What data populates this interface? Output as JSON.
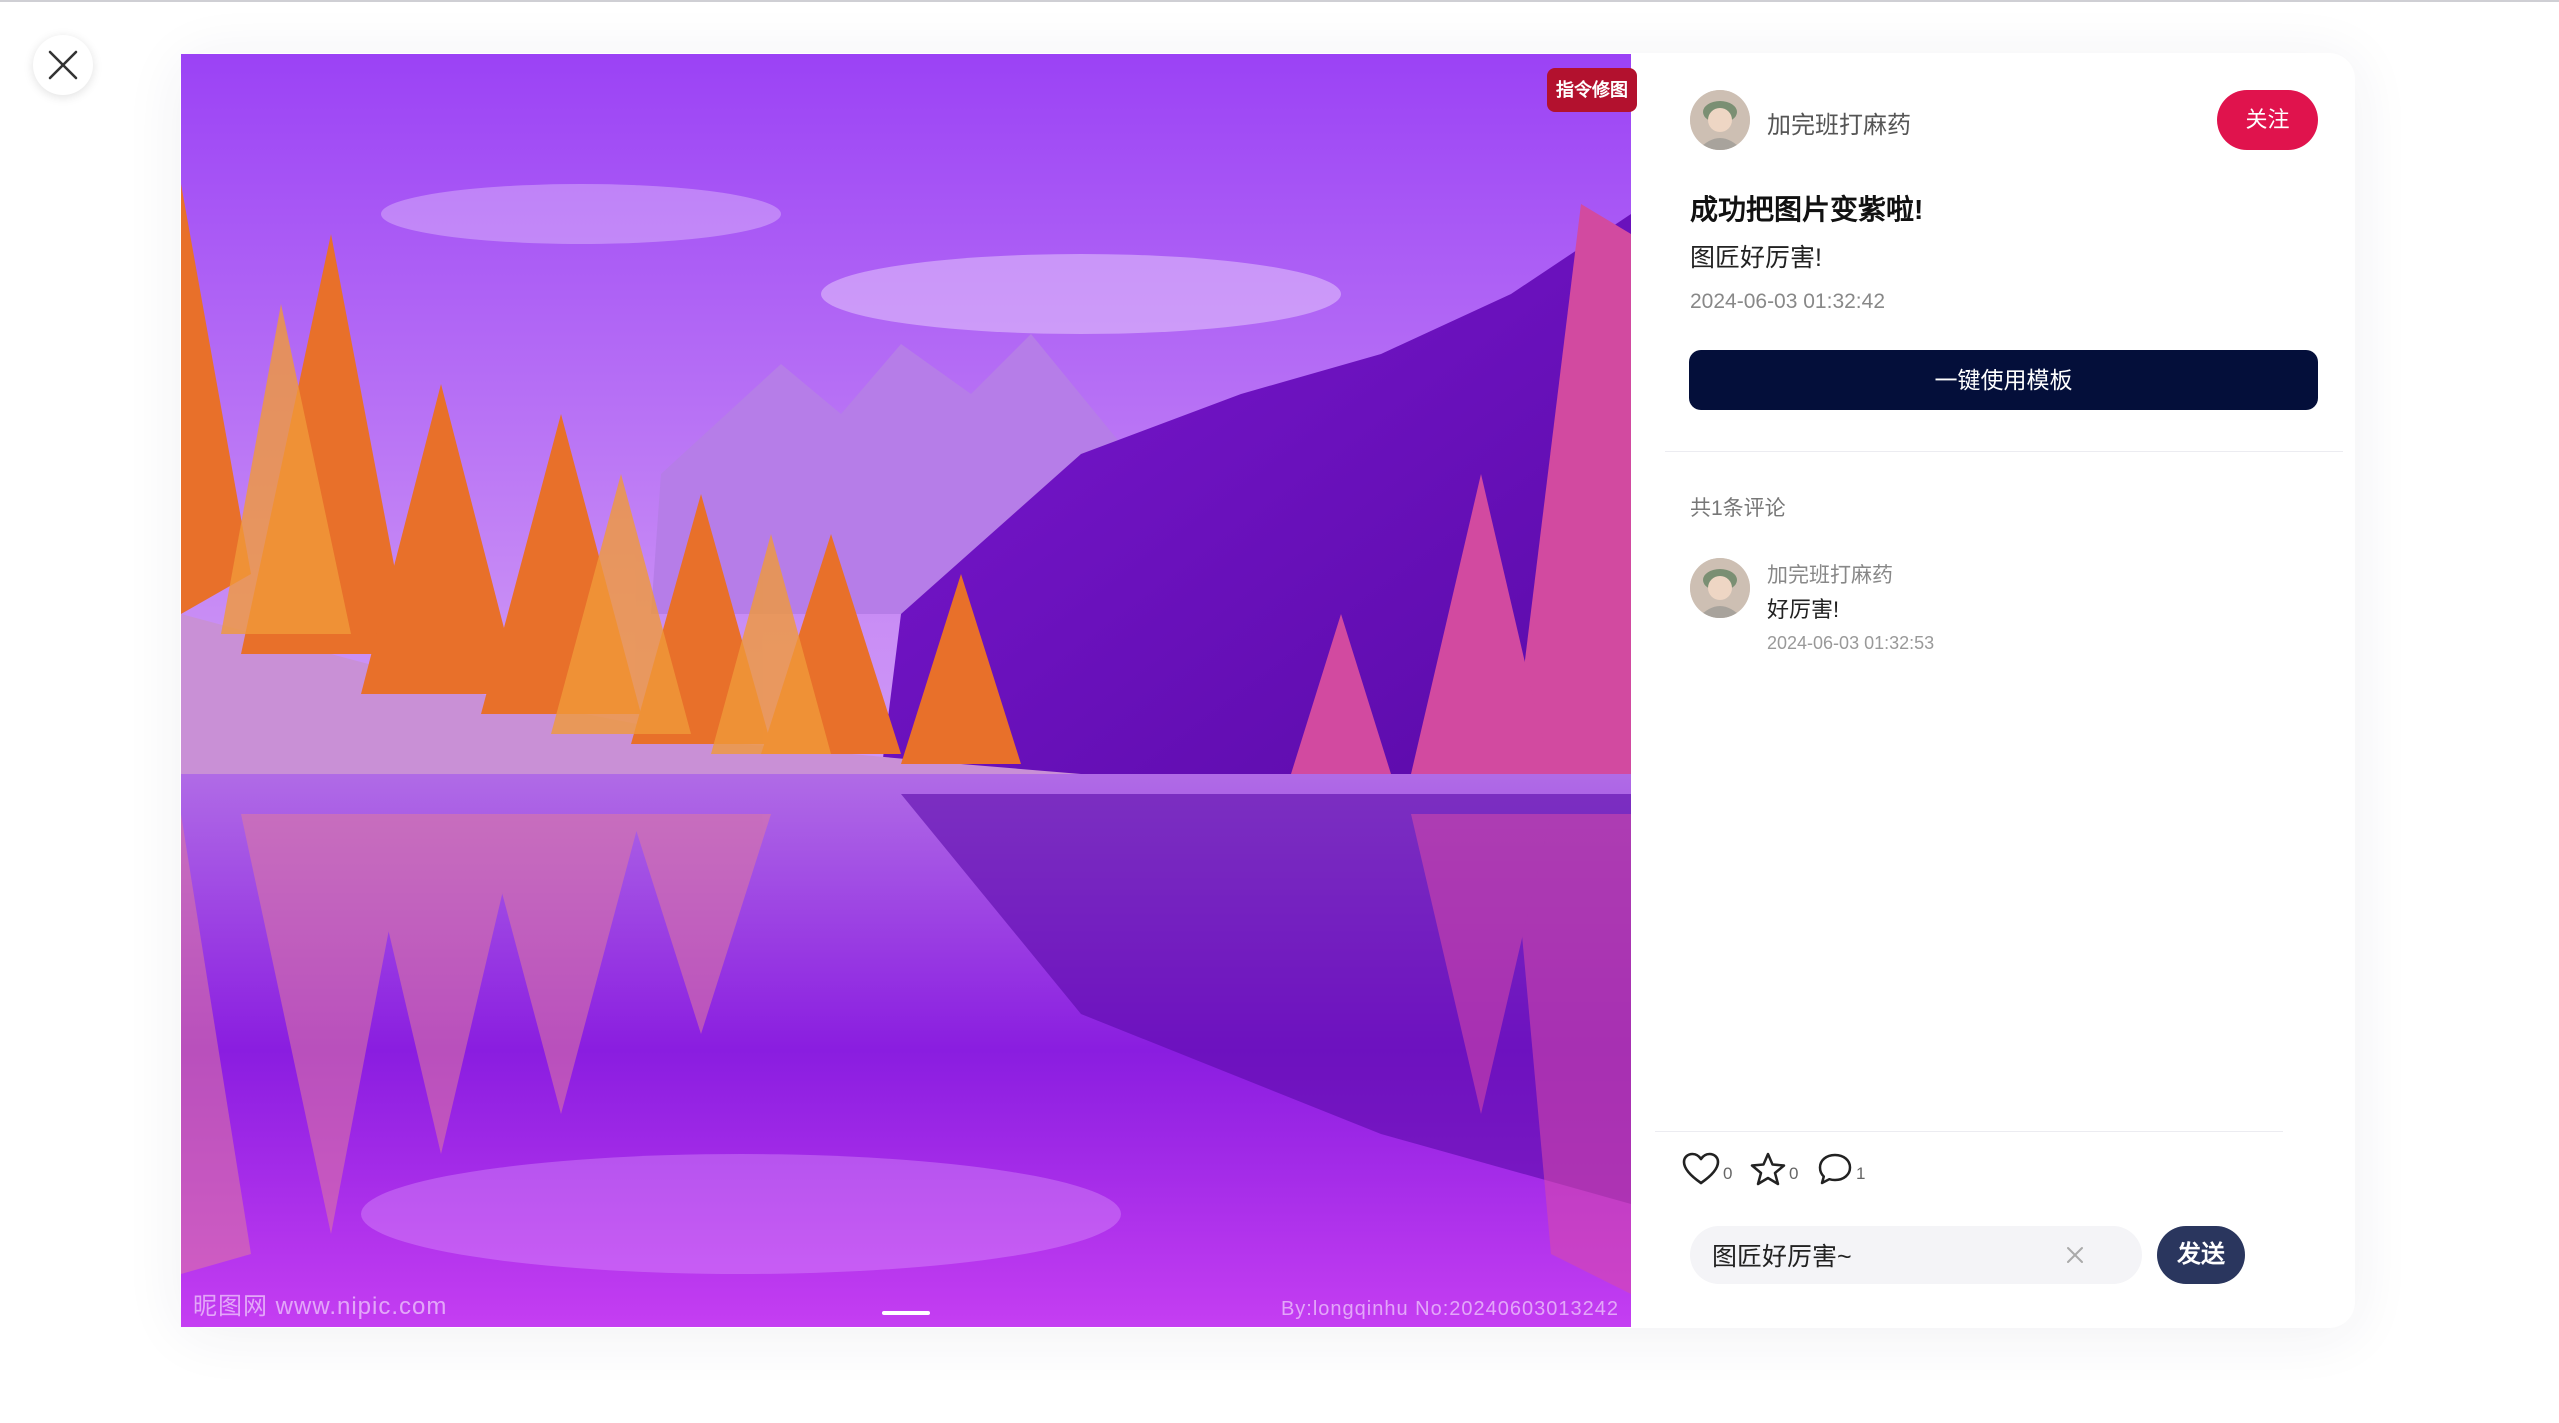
{
  "window": {
    "close_icon": "close-icon"
  },
  "image": {
    "tag_label": "指令修图",
    "watermark_left": "昵图网 www.nipic.com",
    "watermark_right": "By:longqinhu No:20240603013242"
  },
  "author": {
    "name": "加完班打麻药",
    "follow_label": "关注"
  },
  "post": {
    "title": "成功把图片变紫啦!",
    "description": "图匠好厉害!",
    "date": "2024-06-03 01:32:42",
    "use_template_label": "一键使用模板"
  },
  "comments": {
    "count_label": "共1条评论",
    "items": [
      {
        "user": "加完班打麻药",
        "text": "好厉害!",
        "date": "2024-06-03 01:32:53"
      }
    ]
  },
  "actions": {
    "like_count": "0",
    "favorite_count": "0",
    "comment_count": "1"
  },
  "comment_form": {
    "input_value": "图匠好厉害~",
    "send_label": "发送"
  },
  "colors": {
    "follow": "#e0134d",
    "template_button": "#040f3a",
    "send_button": "#2a365e",
    "tag": "#b3112e"
  }
}
